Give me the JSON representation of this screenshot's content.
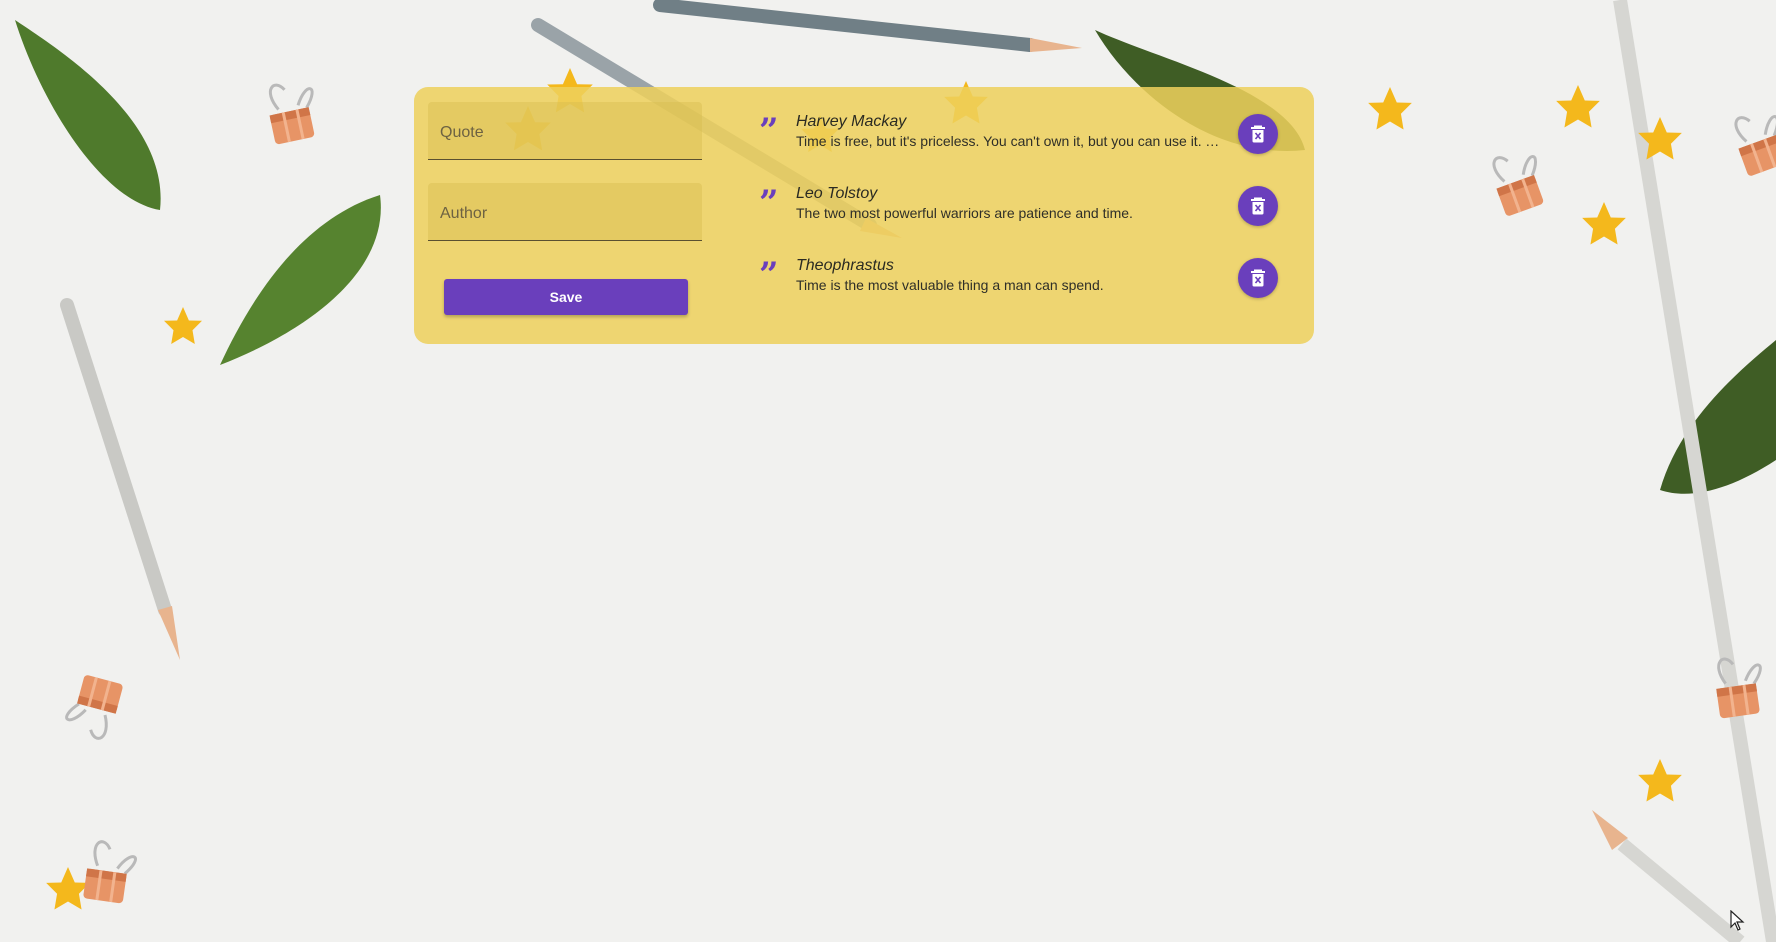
{
  "form": {
    "quote_placeholder": "Quote",
    "author_placeholder": "Author",
    "save_label": "Save"
  },
  "quotes": [
    {
      "author": "Harvey Mackay",
      "text": "Time is free, but it's priceless. You can't own it, but you can use it. You can't keep it, but you can spend it. Once you've lost it you can never get it back."
    },
    {
      "author": "Leo Tolstoy",
      "text": "The two most powerful warriors are patience and time."
    },
    {
      "author": "Theophrastus",
      "text": "Time is the most valuable thing a man can spend."
    }
  ],
  "icons": {
    "quote": "format-quote-icon",
    "delete": "delete-forever-icon"
  },
  "colors": {
    "card": "#eed05c",
    "accent": "#6a3fbc",
    "background": "#f1f1ef"
  }
}
